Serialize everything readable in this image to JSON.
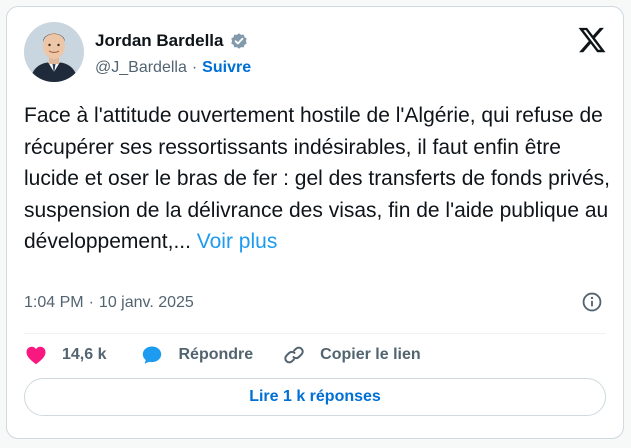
{
  "author": {
    "name": "Jordan Bardella",
    "handle": "@J_Bardella",
    "separator": "·",
    "follow_label": "Suivre",
    "verified": true
  },
  "tweet": {
    "text": "Face à l'attitude ouvertement hostile de l'Algérie, qui refuse de récupérer ses ressortissants indésirables, il faut enfin être lucide et oser le bras de fer : gel des transferts de fonds privés, suspension de la délivrance des visas, fin de l'aide publique au développement,... ",
    "more_label": "Voir plus"
  },
  "meta": {
    "time": "1:04 PM",
    "separator": "·",
    "date": "10 janv. 2025"
  },
  "actions": {
    "likes": "14,6 k",
    "reply_label": "Répondre",
    "copy_label": "Copier le lien"
  },
  "replies_button": "Lire 1 k réponses",
  "icons": {
    "brand": "x-logo-icon",
    "verified": "verified-badge-icon",
    "info": "info-icon",
    "like": "heart-icon",
    "reply": "reply-bubble-icon",
    "copy": "link-icon"
  },
  "colors": {
    "link": "#1d9bf0",
    "follow": "#006fd6",
    "like": "#f91880",
    "reply": "#1d9bf0",
    "muted": "#536471",
    "text": "#0f1419"
  }
}
